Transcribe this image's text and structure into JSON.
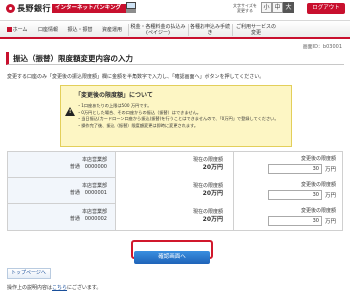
{
  "header": {
    "bank_name": "長野銀行",
    "service_name": "インターネットバンキング",
    "text_size_label": "文字サイズを 変更する",
    "text_size_options": [
      "小",
      "中",
      "大"
    ],
    "logout_label": "ログアウト"
  },
  "nav": {
    "items": [
      {
        "label": "ホーム"
      },
      {
        "label": "口座情報"
      },
      {
        "label": "振込・振替"
      },
      {
        "label": "資産運用"
      },
      {
        "label": "税金・各種料金の払込み (ペイジー)"
      },
      {
        "label": "各種お申込み手続き"
      },
      {
        "label": "ご利用サービスの変更"
      }
    ]
  },
  "page": {
    "id": "画面ID：b03001",
    "title": "振込（振替）限度額変更内容の入力",
    "instruction": "変更する口座のみ「変更後の振込限度額」欄に金額を半角数字で入力し、「確認画面へ」ボタンを押してください。"
  },
  "notice": {
    "heading": "「変更後の限度額」について",
    "items": [
      "・1口座あたりの上限は500 万円です。",
      "・0万円とした場合、その口座からの振込（振替）はできません。",
      "・当日振込(カードローン口座から振込(振替)を行うことはできませんので、「0万円」で登録してください。",
      "・操作完了後、振込（振替）限度額変更は即時に変更されます。"
    ]
  },
  "accounts": [
    {
      "branch": "本店営業部",
      "type": "普通",
      "number": "0000000",
      "current_label": "現在の限度額",
      "current_amount": "20万円",
      "change_label": "変更後の限度額",
      "input_value": "30",
      "unit": "万円"
    },
    {
      "branch": "本店営業部",
      "type": "普通",
      "number": "0000001",
      "current_label": "現在の限度額",
      "current_amount": "20万円",
      "change_label": "変更後の限度額",
      "input_value": "30",
      "unit": "万円"
    },
    {
      "branch": "本店営業部",
      "type": "普通",
      "number": "0000002",
      "current_label": "現在の限度額",
      "current_amount": "20万円",
      "change_label": "変更後の限度額",
      "input_value": "30",
      "unit": "万円"
    }
  ],
  "actions": {
    "confirm_label": "確認画面へ",
    "top_link_label": "トップページへ"
  },
  "footer": {
    "prefix": "操作上の説明内容は",
    "link": "こちら",
    "suffix": "にございます。"
  }
}
